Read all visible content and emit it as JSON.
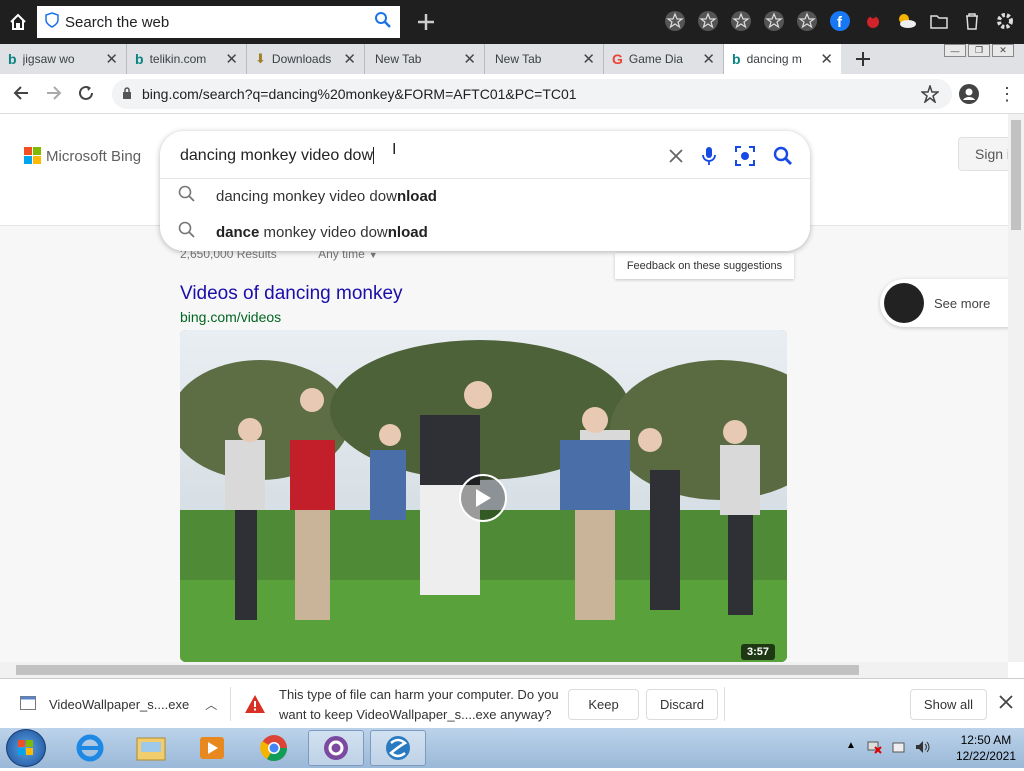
{
  "topbar": {
    "search_label": "Search the web"
  },
  "tabs": [
    {
      "label": "jigsaw wo"
    },
    {
      "label": "telikin.com"
    },
    {
      "label": "Downloads"
    },
    {
      "label": "New Tab"
    },
    {
      "label": "New Tab"
    },
    {
      "label": "Game Dia"
    },
    {
      "label": "dancing m"
    }
  ],
  "address": {
    "url": "bing.com/search?q=dancing%20monkey&FORM=AFTC01&PC=TC01"
  },
  "bing": {
    "logo": "Microsoft Bing",
    "signin": "Sign i",
    "query": "dancing monkey video dow",
    "suggestions": [
      {
        "plain": "dancing monkey video dow",
        "bold": "nload"
      },
      {
        "bold_start": "dance",
        "plain": " monkey video dow",
        "bold": "nload"
      }
    ],
    "results_count": "2,650,000 Results",
    "any_time": "Any time",
    "feedback": "Feedback on these suggestions",
    "video_title": "Videos of dancing monkey",
    "video_source": "bing.com/videos",
    "duration": "3:57",
    "see_more": "See more"
  },
  "download": {
    "file": "VideoWallpaper_s....exe",
    "warning_line1": "This type of file can harm your computer. Do you",
    "warning_line2": "want to keep VideoWallpaper_s....exe anyway?",
    "keep": "Keep",
    "discard": "Discard",
    "show_all": "Show all"
  },
  "taskbar": {
    "time": "12:50 AM",
    "date": "12/22/2021"
  },
  "colors": {
    "link": "#1a0dab",
    "url_green": "#006621",
    "bing_blue": "#0c8484"
  }
}
